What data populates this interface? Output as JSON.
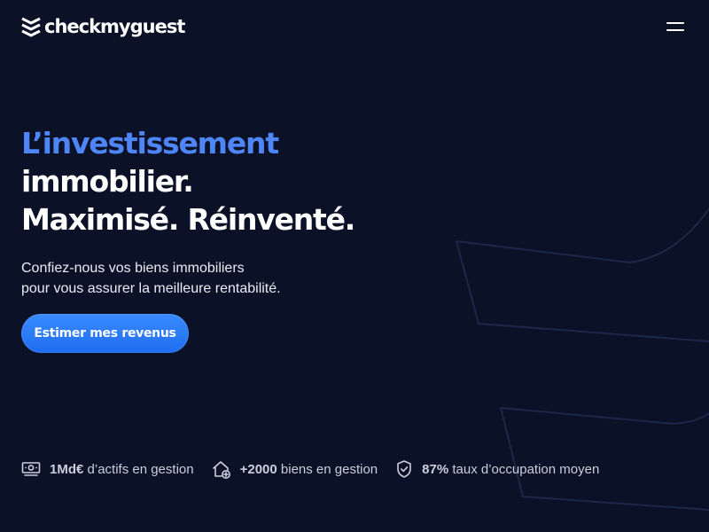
{
  "header": {
    "logo_text": "checkmyguest",
    "logo_icon": "stacked-chevrons-icon",
    "menu_icon": "hamburger-menu-icon"
  },
  "hero": {
    "headline_accent": "L’investissement",
    "headline_line2": "immobilier.",
    "headline_line3": "Maximisé. Réinventé.",
    "subtitle_line1": "Confiez-nous vos biens immobiliers",
    "subtitle_line2": "pour vous assurer la meilleure rentabilité.",
    "cta_label": "Estimer mes revenus"
  },
  "stats": [
    {
      "icon": "money-stack-icon",
      "value": "1Md€",
      "label": "d’actifs en gestion"
    },
    {
      "icon": "house-plus-icon",
      "value": "+2000",
      "label": "biens en gestion"
    },
    {
      "icon": "shield-check-icon",
      "value": "87%",
      "label": "taux d’occupation moyen"
    }
  ],
  "colors": {
    "background": "#0b1127",
    "accent": "#4f86f7",
    "button": "#2a7bff",
    "stat_text": "#c9cfdd"
  }
}
